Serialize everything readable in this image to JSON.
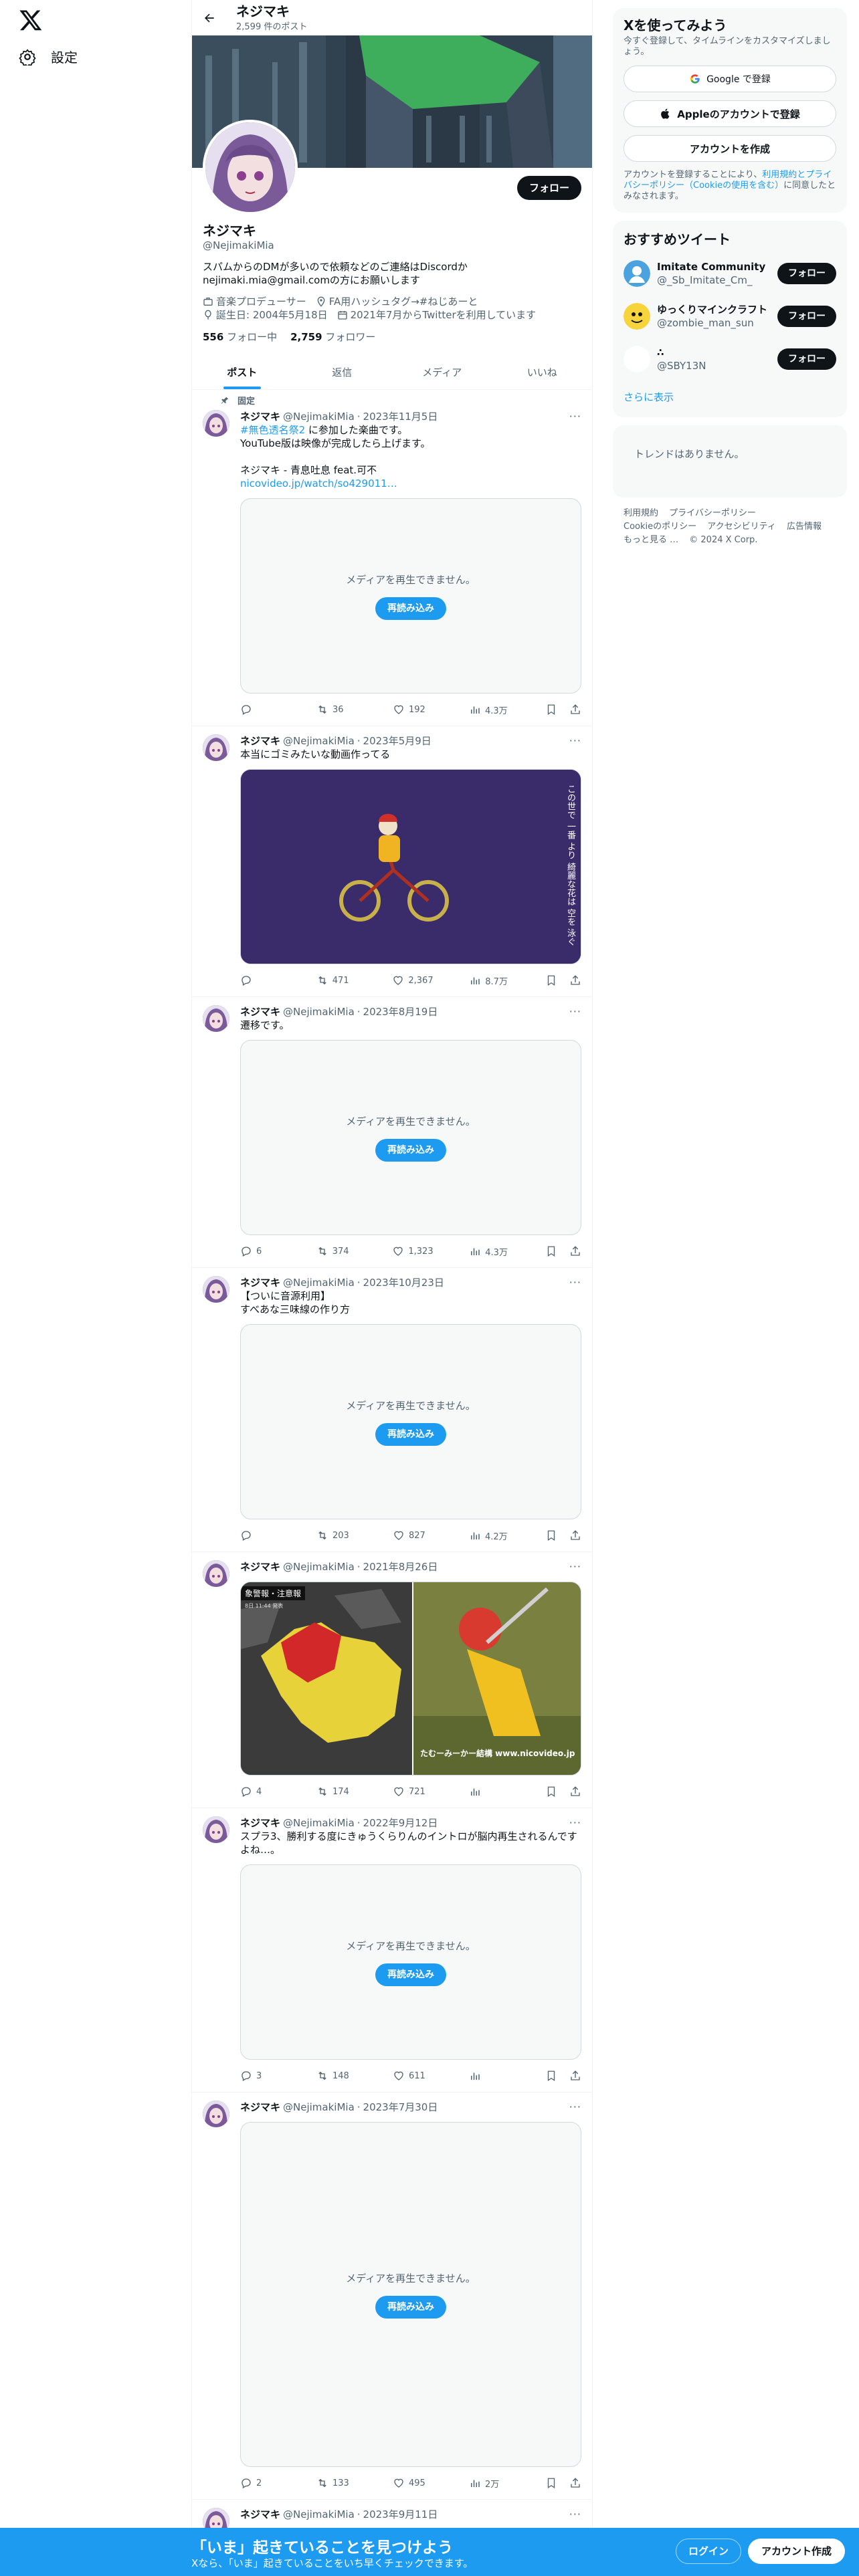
{
  "nav": {
    "settings_label": "設定"
  },
  "header": {
    "name": "ネジマキ",
    "post_count": "2,599 件のポスト"
  },
  "profile": {
    "follow_label": "フォロー",
    "name": "ネジマキ",
    "handle": "@NejimakiMia",
    "bio_line1": "スパムからのDMが多いので依頼などのご連絡はDiscordか",
    "bio_line2": "nejimaki.mia@gmail.comの方にお願いします",
    "job": "音楽プロデューサー",
    "location": "FA用ハッシュタグ→#ねじあーと",
    "birthday": "誕生日: 2004年5月18日",
    "joined": "2021年7月からTwitterを利用しています",
    "following_count": "556",
    "following_label": "フォロー中",
    "followers_count": "2,759",
    "followers_label": "フォロワー"
  },
  "tabs": [
    "ポスト",
    "返信",
    "メディア",
    "いいね"
  ],
  "pinned_label": "固定",
  "media_error": "メディアを再生できません。",
  "reload_label": "再読み込み",
  "tweets": [
    {
      "name": "ネジマキ",
      "handle": "@NejimakiMia",
      "date": "2023年11月5日",
      "hashtag": "#無色透名祭2",
      "text_after_tag": " に参加した楽曲です。",
      "text_rest": "YouTube版は映像が完成したら上げます。\n\nネジマキ - 青息吐息 feat.可不",
      "url": "nicovideo.jp/watch/so429011…",
      "replies": "",
      "reposts": "36",
      "likes": "192",
      "views": "4.3万"
    },
    {
      "name": "ネジマキ",
      "handle": "@NejimakiMia",
      "date": "2023年5月9日",
      "text": "本当にゴミみたいな動画作ってる",
      "overlay_text": "この世で 一番 より 綺麗な花は 空を 泳ぐ",
      "replies": "",
      "reposts": "471",
      "likes": "2,367",
      "views": "8.7万"
    },
    {
      "name": "ネジマキ",
      "handle": "@NejimakiMia",
      "date": "2023年8月19日",
      "text": "遷移です。",
      "replies": "6",
      "reposts": "374",
      "likes": "1,323",
      "views": "4.3万"
    },
    {
      "name": "ネジマキ",
      "handle": "@NejimakiMia",
      "date": "2023年10月23日",
      "text": "【ついに音源利用】\nすべあな三味線の作り方",
      "replies": "",
      "reposts": "203",
      "likes": "827",
      "views": "4.2万"
    },
    {
      "name": "ネジマキ",
      "handle": "@NejimakiMia",
      "date": "2021年8月26日",
      "map_label": "象警報・注意報",
      "map_time": "8日 11:44 発表",
      "image_caption": "たむーみーかー結構 www.nicovideo.jp",
      "replies": "4",
      "reposts": "174",
      "likes": "721",
      "views": ""
    },
    {
      "name": "ネジマキ",
      "handle": "@NejimakiMia",
      "date": "2022年9月12日",
      "text": "スプラ3、勝利する度にきゅうくらりんのイントロが脳内再生されるんですよね…。",
      "replies": "3",
      "reposts": "148",
      "likes": "611",
      "views": ""
    },
    {
      "name": "ネジマキ",
      "handle": "@NejimakiMia",
      "date": "2023年7月30日",
      "text": "",
      "replies": "2",
      "reposts": "133",
      "likes": "495",
      "views": "2万"
    },
    {
      "name": "ネジマキ",
      "handle": "@NejimakiMia",
      "date": "2023年9月11日"
    }
  ],
  "sidebar": {
    "signup_title": "Xを使ってみよう",
    "signup_sub": "今すぐ登録して、タイムラインをカスタマイズしましょう。",
    "google_btn": "Google で登録",
    "apple_btn": "Appleのアカウントで登録",
    "create_btn": "アカウントを作成",
    "legal_pre": "アカウントを登録することにより、",
    "legal_links": "利用規約とプライバシーポリシー（Cookieの使用を含む）",
    "legal_post": "に同意したとみなされます。",
    "reco_title": "おすすめツイート",
    "reco_users": [
      {
        "name": "Imitate Community",
        "handle": "@_Sb_Imitate_Cm_",
        "color": "#4aa3df"
      },
      {
        "name": "ゆっくりマインクラフト",
        "handle": "@zombie_man_sun",
        "color": "#f4c430"
      },
      {
        "name": "∴",
        "handle": "@SBY13N",
        "color": "#ffffff"
      }
    ],
    "reco_follow": "フォロー",
    "show_more": "さらに表示",
    "trends_empty": "トレンドはありません。",
    "footer_links": [
      "利用規約",
      "プライバシーポリシー",
      "Cookieのポリシー",
      "アクセシビリティ",
      "広告情報",
      "もっと見る …",
      "© 2024 X Corp."
    ]
  },
  "bottom": {
    "title": "「いま」起きていることを見つけよう",
    "sub": "Xなら、「いま」起きていることをいち早くチェックできます。",
    "login": "ログイン",
    "signup": "アカウント作成"
  },
  "colors": {
    "accent": "#1d9bf0",
    "text": "#0f1419",
    "muted": "#536471"
  }
}
